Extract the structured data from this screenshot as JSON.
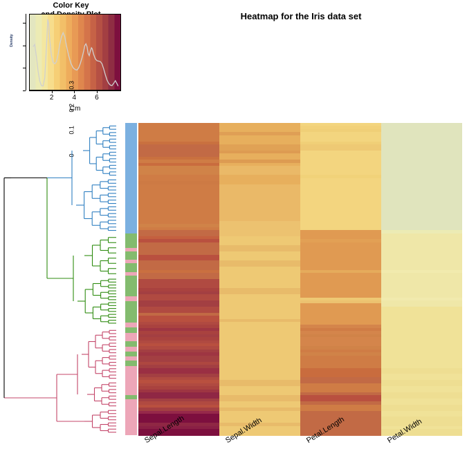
{
  "color_key": {
    "title_line1": "Color Key",
    "title_line2": "and Density Plot",
    "xlabel": "Cm",
    "ylabel": "Density",
    "y_ticks": [
      "0",
      "0.1",
      "0.2",
      "0.3"
    ],
    "x_ticks": [
      "2",
      "4",
      "6"
    ],
    "gradient_stops": [
      "#e3e6c0",
      "#ecebb4",
      "#f4e79f",
      "#f7dd8c",
      "#f6cf76",
      "#f2bf68",
      "#eeac5c",
      "#e89a55",
      "#df874e",
      "#d4744a",
      "#c66246",
      "#b55044",
      "#a33f42",
      "#8f2d43",
      "#7d0f3e"
    ],
    "density_color": "#d0d0d0"
  },
  "header": {
    "title": "Heatmap for the Iris data set"
  },
  "chart_data": {
    "type": "heatmap",
    "title": "Heatmap for the Iris data set",
    "columns": [
      "Sepal.Length",
      "Sepal.Width",
      "Petal.Length",
      "Petal.Width"
    ],
    "value_unit": "Cm",
    "colorbar_range": [
      0,
      8
    ],
    "colorbar_ticks": [
      2,
      4,
      6
    ],
    "density": {
      "ylabel": "Density",
      "xlabel": "Cm",
      "ylim": [
        0,
        0.34
      ],
      "y_ticks": [
        0,
        0.1,
        0.2,
        0.3
      ],
      "x_ticks": [
        2,
        4,
        6
      ],
      "curve": [
        [
          0.3,
          0.195
        ],
        [
          0.45,
          0.205
        ],
        [
          0.6,
          0.15
        ],
        [
          0.75,
          0.085
        ],
        [
          0.9,
          0.04
        ],
        [
          1.05,
          0.02
        ],
        [
          1.2,
          0.018
        ],
        [
          1.35,
          0.055
        ],
        [
          1.45,
          0.145
        ],
        [
          1.55,
          0.245
        ],
        [
          1.62,
          0.318
        ],
        [
          1.7,
          0.3
        ],
        [
          1.8,
          0.225
        ],
        [
          1.95,
          0.155
        ],
        [
          2.1,
          0.125
        ],
        [
          2.25,
          0.118
        ],
        [
          2.4,
          0.128
        ],
        [
          2.55,
          0.16
        ],
        [
          2.7,
          0.205
        ],
        [
          2.85,
          0.24
        ],
        [
          3.0,
          0.258
        ],
        [
          3.15,
          0.24
        ],
        [
          3.3,
          0.2
        ],
        [
          3.5,
          0.155
        ],
        [
          3.7,
          0.12
        ],
        [
          3.9,
          0.1
        ],
        [
          4.1,
          0.092
        ],
        [
          4.25,
          0.09
        ],
        [
          4.4,
          0.1
        ],
        [
          4.55,
          0.12
        ],
        [
          4.7,
          0.145
        ],
        [
          4.85,
          0.175
        ],
        [
          4.95,
          0.2
        ],
        [
          5.05,
          0.208
        ],
        [
          5.15,
          0.195
        ],
        [
          5.25,
          0.165
        ],
        [
          5.35,
          0.155
        ],
        [
          5.45,
          0.175
        ],
        [
          5.55,
          0.19
        ],
        [
          5.62,
          0.185
        ],
        [
          5.75,
          0.16
        ],
        [
          5.9,
          0.14
        ],
        [
          6.05,
          0.132
        ],
        [
          6.2,
          0.13
        ],
        [
          6.35,
          0.128
        ],
        [
          6.5,
          0.118
        ],
        [
          6.65,
          0.095
        ],
        [
          6.8,
          0.068
        ],
        [
          6.95,
          0.045
        ],
        [
          7.1,
          0.03
        ],
        [
          7.25,
          0.022
        ],
        [
          7.4,
          0.02
        ],
        [
          7.55,
          0.03
        ],
        [
          7.7,
          0.042
        ],
        [
          7.85,
          0.028
        ],
        [
          7.95,
          0.018
        ]
      ]
    },
    "row_side_colors": {
      "legend": {
        "setosa": "#7bb0e0",
        "versicolor": "#83bb6e",
        "virginica": "#eda6b8"
      },
      "bands": [
        {
          "color": "#7bb0e0",
          "start": 0.0,
          "end": 0.355
        },
        {
          "color": "#83bb6e",
          "start": 0.355,
          "end": 0.4
        },
        {
          "color": "#eda6b8",
          "start": 0.4,
          "end": 0.412
        },
        {
          "color": "#83bb6e",
          "start": 0.412,
          "end": 0.437
        },
        {
          "color": "#eda6b8",
          "start": 0.437,
          "end": 0.449
        },
        {
          "color": "#83bb6e",
          "start": 0.449,
          "end": 0.478
        },
        {
          "color": "#eda6b8",
          "start": 0.478,
          "end": 0.49
        },
        {
          "color": "#83bb6e",
          "start": 0.49,
          "end": 0.555
        },
        {
          "color": "#eda6b8",
          "start": 0.555,
          "end": 0.57
        },
        {
          "color": "#83bb6e",
          "start": 0.57,
          "end": 0.64
        },
        {
          "color": "#eda6b8",
          "start": 0.64,
          "end": 0.655
        },
        {
          "color": "#83bb6e",
          "start": 0.655,
          "end": 0.672
        },
        {
          "color": "#eda6b8",
          "start": 0.672,
          "end": 0.7
        },
        {
          "color": "#83bb6e",
          "start": 0.7,
          "end": 0.716
        },
        {
          "color": "#eda6b8",
          "start": 0.716,
          "end": 0.732
        },
        {
          "color": "#83bb6e",
          "start": 0.732,
          "end": 0.748
        },
        {
          "color": "#eda6b8",
          "start": 0.748,
          "end": 0.762
        },
        {
          "color": "#83bb6e",
          "start": 0.762,
          "end": 0.778
        },
        {
          "color": "#eda6b8",
          "start": 0.778,
          "end": 0.872
        },
        {
          "color": "#83bb6e",
          "start": 0.872,
          "end": 0.884
        },
        {
          "color": "#eda6b8",
          "start": 0.884,
          "end": 1.0
        }
      ]
    },
    "column_colors": {
      "Sepal.Length": [
        "#cf7c45",
        "#cf7c45",
        "#cf7c45",
        "#cf7c45",
        "#cf7c45",
        "#cf7c45",
        "#c9713f",
        "#c26a45",
        "#c26a45",
        "#c26a45",
        "#c26a45",
        "#c9713f",
        "#cf7c45",
        "#c96c3e",
        "#d08348",
        "#d08348",
        "#d08348",
        "#cf7c45",
        "#cf7c45",
        "#cd7a44",
        "#cf7c45",
        "#cf7c45",
        "#cf7c45",
        "#cf7c45",
        "#cf7c45",
        "#cf7c45",
        "#cf7c45",
        "#cf7c45",
        "#cf7c45",
        "#cf7c45",
        "#cf7c45",
        "#cf7c45",
        "#cf7c45",
        "#d08348",
        "#cf7c45",
        "#c26a45",
        "#c26a45",
        "#c4603f",
        "#b9503f",
        "#c26a45",
        "#c26a45",
        "#c26a45",
        "#c26a45",
        "#b9503f",
        "#b9503f",
        "#c26a45",
        "#c26a45",
        "#c26a45",
        "#ca7040",
        "#c26a45",
        "#c26a45",
        "#b04a41",
        "#b04a41",
        "#b04a41",
        "#a9423f",
        "#a33f42",
        "#b04a41",
        "#b04a41",
        "#a33f42",
        "#a33f42",
        "#b04a41",
        "#b04a41",
        "#c26a45",
        "#b9503f",
        "#b9503f",
        "#b04a41",
        "#a9423f",
        "#9e3542",
        "#a9423f",
        "#a33f42",
        "#a9423f",
        "#b04a41",
        "#b9503f",
        "#b04a41",
        "#a33f42",
        "#9e3542",
        "#a33f42",
        "#a33f42",
        "#ae4740",
        "#a33f42",
        "#9a2f43",
        "#9a2f43",
        "#a33f42",
        "#b04a41",
        "#b9503f",
        "#b04a41",
        "#a9423f",
        "#9e3542",
        "#8f2744",
        "#8f2744",
        "#a33f42",
        "#b04a41",
        "#b9503f",
        "#a33f42",
        "#96284a",
        "#7d0f3e",
        "#7d0f3e",
        "#7d0f3e",
        "#8f2744",
        "#8a2045",
        "#7d0f3e",
        "#7d0f3e"
      ],
      "Sepal.Width": [
        "#e7af5d",
        "#e7af5d",
        "#e7af5d",
        "#df9f55",
        "#e7af5d",
        "#e7af5d",
        "#e7af5d",
        "#e0a255",
        "#e0a255",
        "#dd9b52",
        "#e7af5d",
        "#e7af5d",
        "#dd9b52",
        "#e7af5d",
        "#eab968",
        "#eab968",
        "#eab968",
        "#e7af5d",
        "#e7af5d",
        "#e7af5d",
        "#eab968",
        "#eab968",
        "#eab968",
        "#eab968",
        "#eab968",
        "#eab968",
        "#eab968",
        "#eab968",
        "#eab968",
        "#eab968",
        "#eab968",
        "#eab968",
        "#ecc270",
        "#ecc270",
        "#ecc270",
        "#ecc270",
        "#ecc270",
        "#eec974",
        "#eec974",
        "#eec974",
        "#e8bb6a",
        "#e8bb6a",
        "#eec974",
        "#eec974",
        "#eec974",
        "#e8bb6a",
        "#e8bb6a",
        "#eec974",
        "#eec974",
        "#eec974",
        "#eec974",
        "#eec974",
        "#eec974",
        "#eec974",
        "#e8bb6a",
        "#e8bb6a",
        "#eec974",
        "#eec974",
        "#eec974",
        "#eec974",
        "#eec974",
        "#eec974",
        "#eec974",
        "#eec974",
        "#e8bb6a",
        "#eec974",
        "#eec974",
        "#eec974",
        "#eec974",
        "#eec974",
        "#eec974",
        "#eec974",
        "#eec974",
        "#eec974",
        "#eec974",
        "#eec974",
        "#eec974",
        "#eec974",
        "#eec974",
        "#eec974",
        "#eec974",
        "#eec974",
        "#eec974",
        "#eec974",
        "#e8bb6a",
        "#e8bb6a",
        "#eec974",
        "#eec974",
        "#eec974",
        "#e8bb6a",
        "#e8bb6a",
        "#eec974",
        "#eec974",
        "#e8bb6a",
        "#eec974",
        "#eec974",
        "#eec974",
        "#eec974",
        "#e8bb6a",
        "#eec974",
        "#eec974",
        "#eec974"
      ],
      "Petal.Length": [
        "#f3d57f",
        "#f2d179",
        "#f0cf77",
        "#f3d57f",
        "#f3d57f",
        "#f3d57f",
        "#f0cf77",
        "#eec974",
        "#eec974",
        "#f3d57f",
        "#f3d57f",
        "#f3d57f",
        "#f3d57f",
        "#f3d57f",
        "#f3d57f",
        "#f3d57f",
        "#f3d57f",
        "#f1d279",
        "#f3d57f",
        "#f3d57f",
        "#f3d57f",
        "#f3d57f",
        "#f3d57f",
        "#f3d57f",
        "#f3d57f",
        "#f3d57f",
        "#f3d57f",
        "#f3d57f",
        "#f3d57f",
        "#f3d57f",
        "#f3d57f",
        "#f3d57f",
        "#f3d57f",
        "#f3d57f",
        "#f3d57f",
        "#e09a52",
        "#e09a52",
        "#e09a52",
        "#e2a055",
        "#e09a52",
        "#e09a52",
        "#e09a52",
        "#e09a52",
        "#e09a52",
        "#e09a52",
        "#e09a52",
        "#e09a52",
        "#e09a52",
        "#e5ab5c",
        "#e09a52",
        "#e09a52",
        "#e09a52",
        "#e09a52",
        "#e09a52",
        "#e09a52",
        "#e09a52",
        "#e09a52",
        "#eec974",
        "#ecc270",
        "#e09a52",
        "#e09a52",
        "#e09a52",
        "#e09a52",
        "#e09a52",
        "#e09a52",
        "#e09a52",
        "#d4854b",
        "#cf7c45",
        "#d4854b",
        "#d08348",
        "#d4854b",
        "#d4854b",
        "#d4854b",
        "#d08348",
        "#cf7c45",
        "#d08348",
        "#cf7c45",
        "#cf7c45",
        "#cf7c45",
        "#cf7c45",
        "#c96c3e",
        "#c96c3e",
        "#c96c3e",
        "#c26a45",
        "#c26a45",
        "#cf7c45",
        "#cf7c45",
        "#cf7c45",
        "#c26a45",
        "#b9503f",
        "#b9503f",
        "#c26a45",
        "#cf7c45",
        "#cf7c45",
        "#c26a45",
        "#c26a45",
        "#c26a45",
        "#c26a45",
        "#c26a45",
        "#c26a45",
        "#c26a45",
        "#c26a45"
      ],
      "Petal.Width": [
        "#e0e4bd",
        "#e0e4bd",
        "#e0e4bd",
        "#e0e4bd",
        "#e0e4bd",
        "#e0e4bd",
        "#e0e4bd",
        "#e0e4bd",
        "#e0e4bd",
        "#e0e4bd",
        "#e0e4bd",
        "#e0e4bd",
        "#e0e4bd",
        "#e0e4bd",
        "#e0e4bd",
        "#e0e4bd",
        "#e0e4bd",
        "#e0e4bd",
        "#e0e4bd",
        "#e0e4bd",
        "#e0e4bd",
        "#e0e4bd",
        "#e0e4bd",
        "#e0e4bd",
        "#e0e4bd",
        "#e0e4bd",
        "#e0e4bd",
        "#e0e4bd",
        "#e0e4bd",
        "#e0e4bd",
        "#e0e4bd",
        "#e0e4bd",
        "#e0e4bd",
        "#e0e4bd",
        "#e0e4bd",
        "#ecebb4",
        "#efe7a8",
        "#efe7a8",
        "#efe7a8",
        "#efe7a8",
        "#efe7a8",
        "#efe7a8",
        "#efe7a8",
        "#efe7a8",
        "#efe7a8",
        "#efe7a8",
        "#efe7a8",
        "#efe7a8",
        "#f1eaae",
        "#efe7a8",
        "#efe7a8",
        "#efe7a8",
        "#efe7a8",
        "#efe7a8",
        "#efe7a8",
        "#efe7a8",
        "#efe7a8",
        "#f1eaae",
        "#efe7a8",
        "#efe7a8",
        "#f0e298",
        "#f0e298",
        "#f0e298",
        "#f0e298",
        "#f0e298",
        "#f0e298",
        "#f0e298",
        "#f0e298",
        "#f0e298",
        "#f0e298",
        "#f0e298",
        "#f0e298",
        "#f0e298",
        "#f0e298",
        "#f0e298",
        "#f0e298",
        "#f0e298",
        "#f0e298",
        "#f0e298",
        "#f0e298",
        "#eede92",
        "#eede92",
        "#f0e298",
        "#f0e298",
        "#eede92",
        "#eede92",
        "#f0e298",
        "#f0e298",
        "#eede92",
        "#eede92",
        "#f0e298",
        "#f0e298",
        "#eede92",
        "#eede92",
        "#f0e298",
        "#f0e298",
        "#eede92",
        "#eede92",
        "#eede92",
        "#f0e298",
        "#eede92",
        "#eede92"
      ]
    },
    "dendrogram": {
      "root_color": "#000000",
      "cluster_colors": [
        "#2e7fc1",
        "#2e8b0f",
        "#c44569"
      ],
      "description": "Row dendrogram, 3 colored clusters (blue top, green middle, crimson bottom) joined by a black root"
    }
  },
  "columns_axis": {
    "labels": [
      "Sepal.Length",
      "Sepal.Width",
      "Petal.Length",
      "Petal.Width"
    ]
  }
}
